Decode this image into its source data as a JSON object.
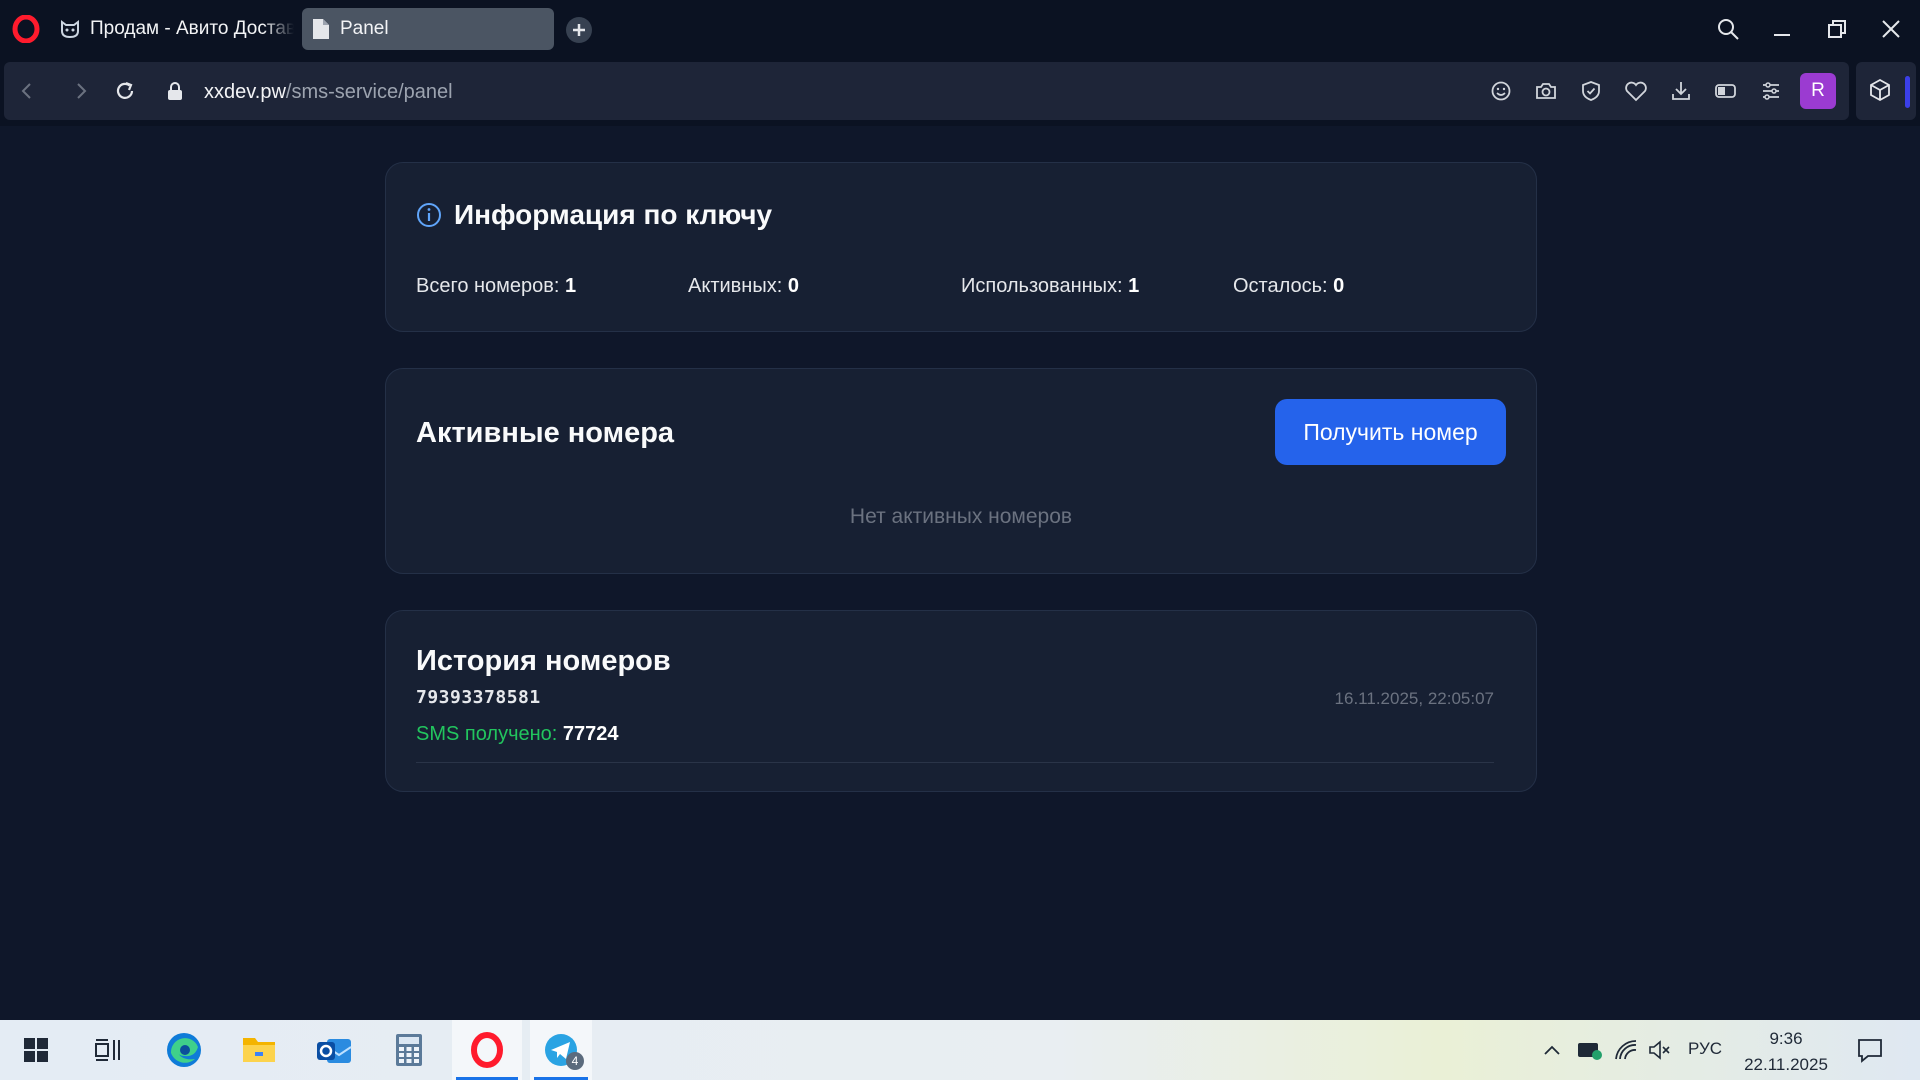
{
  "browser": {
    "tabs": [
      {
        "label": "Продам - Авито Доставка",
        "active": false
      },
      {
        "label": "Panel",
        "active": true
      }
    ],
    "url": {
      "host": "xxdev.pw",
      "path": "/sms-service/panel"
    },
    "profile_initial": "R",
    "accent_color": "#3b3fe8"
  },
  "page": {
    "info": {
      "title": "Информация по ключу",
      "stats": [
        {
          "label": "Всего номеров:",
          "value": "1"
        },
        {
          "label": "Активных:",
          "value": "0"
        },
        {
          "label": "Использованных:",
          "value": "1"
        },
        {
          "label": "Осталось:",
          "value": "0"
        }
      ]
    },
    "active": {
      "title": "Активные номера",
      "button_label": "Получить номер",
      "empty_message": "Нет активных номеров"
    },
    "history": {
      "title": "История номеров",
      "items": [
        {
          "number": "79393378581",
          "date": "16.11.2025, 22:05:07",
          "sms_label": "SMS получено:",
          "sms_code": "77724"
        }
      ]
    },
    "colors": {
      "primary_button": "#2563eb",
      "success_text": "#22c55e",
      "card_bg": "#172033",
      "page_bg": "#0f172a"
    }
  },
  "taskbar": {
    "telegram_badge": "4",
    "language": "РУС",
    "time": "9:36",
    "date": "22.11.2025",
    "icons": [
      "windows-start-icon",
      "task-view-icon",
      "edge-icon",
      "file-explorer-icon",
      "outlook-icon",
      "calculator-icon",
      "opera-icon",
      "telegram-icon"
    ]
  }
}
